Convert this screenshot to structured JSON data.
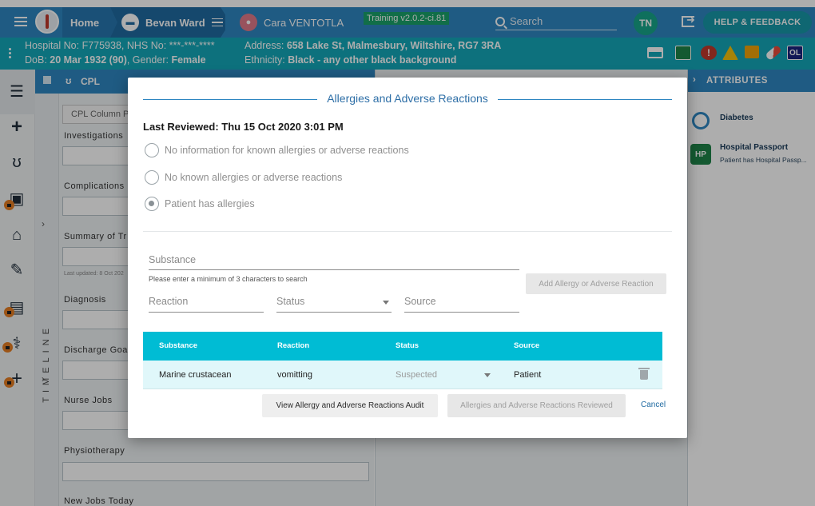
{
  "nav": {
    "home_label": "Home",
    "patient_label": "Bevan Ward",
    "user_label": "Cara VENTOTLA",
    "training_badge": "Training v2.0.2-ci.81",
    "search_placeholder": "Search",
    "avatar_initials": "TN",
    "help_label": "HELP & FEEDBACK",
    "colors": {
      "primary": "#2e86c1",
      "banner": "#14a7b8",
      "accent": "#00bcd4"
    }
  },
  "banner": {
    "hospital_prefix": "Hospital No: ",
    "hospital_no": "F775938",
    "nhs_prefix": ", NHS No: ",
    "nhs_no": "***-***-****",
    "dob_prefix": "DoB: ",
    "dob": "20 Mar 1932 (90)",
    "gender_prefix": ", Gender: ",
    "gender": "Female",
    "address_prefix": "Address: ",
    "address": "658 Lake St, Malmesbury, Wiltshire, RG7 3RA",
    "ethnicity_prefix": "Ethnicity: ",
    "ethnicity": "Black - any other black background",
    "indicators": [
      "bed-icon",
      "screen-icon",
      "alert-icon",
      "warning-icon",
      "notes-icon",
      "pill-icon",
      "ol-badge"
    ],
    "ol_badge": "OL"
  },
  "timeline": {
    "label": "TIMELINE"
  },
  "cpl": {
    "tab_label": "CPL",
    "column_placeholder": "CPL Column P",
    "labels": [
      "Investigations",
      "Complications",
      "Summary of Tr",
      "Diagnosis",
      "Discharge Goa",
      "Nurse Jobs",
      "Physiotherapy",
      "New Jobs Today"
    ],
    "last_updated": "Last updated: 8 Oct 202"
  },
  "attributes": {
    "header": "ATTRIBUTES",
    "items": [
      {
        "title": "Diabetes",
        "subtitle": ""
      },
      {
        "badge": "HP",
        "title": "Hospital Passport",
        "subtitle": "Patient has Hospital Passp..."
      }
    ]
  },
  "modal": {
    "title": "Allergies and Adverse Reactions",
    "last_reviewed": "Last Reviewed: Thu 15 Oct 2020 3:01 PM",
    "options": [
      {
        "label": "No information for known allergies or adverse reactions",
        "checked": false
      },
      {
        "label": "No known allergies or adverse reactions",
        "checked": false
      },
      {
        "label": "Patient has allergies",
        "checked": true
      }
    ],
    "substance_placeholder": "Substance",
    "substance_hint": "Please enter a minimum of 3 characters to search",
    "reaction_placeholder": "Reaction",
    "status_placeholder": "Status",
    "source_placeholder": "Source",
    "add_button": "Add Allergy or Adverse Reaction",
    "table": {
      "headers": [
        "Substance",
        "Reaction",
        "Status",
        "Source"
      ],
      "rows": [
        {
          "substance": "Marine crustacean",
          "reaction": "vomitting",
          "status": "Suspected",
          "source": "Patient"
        }
      ]
    },
    "audit_button": "View Allergy and Adverse Reactions Audit",
    "reviewed_button": "Allergies and Adverse Reactions Reviewed",
    "cancel_button": "Cancel"
  }
}
